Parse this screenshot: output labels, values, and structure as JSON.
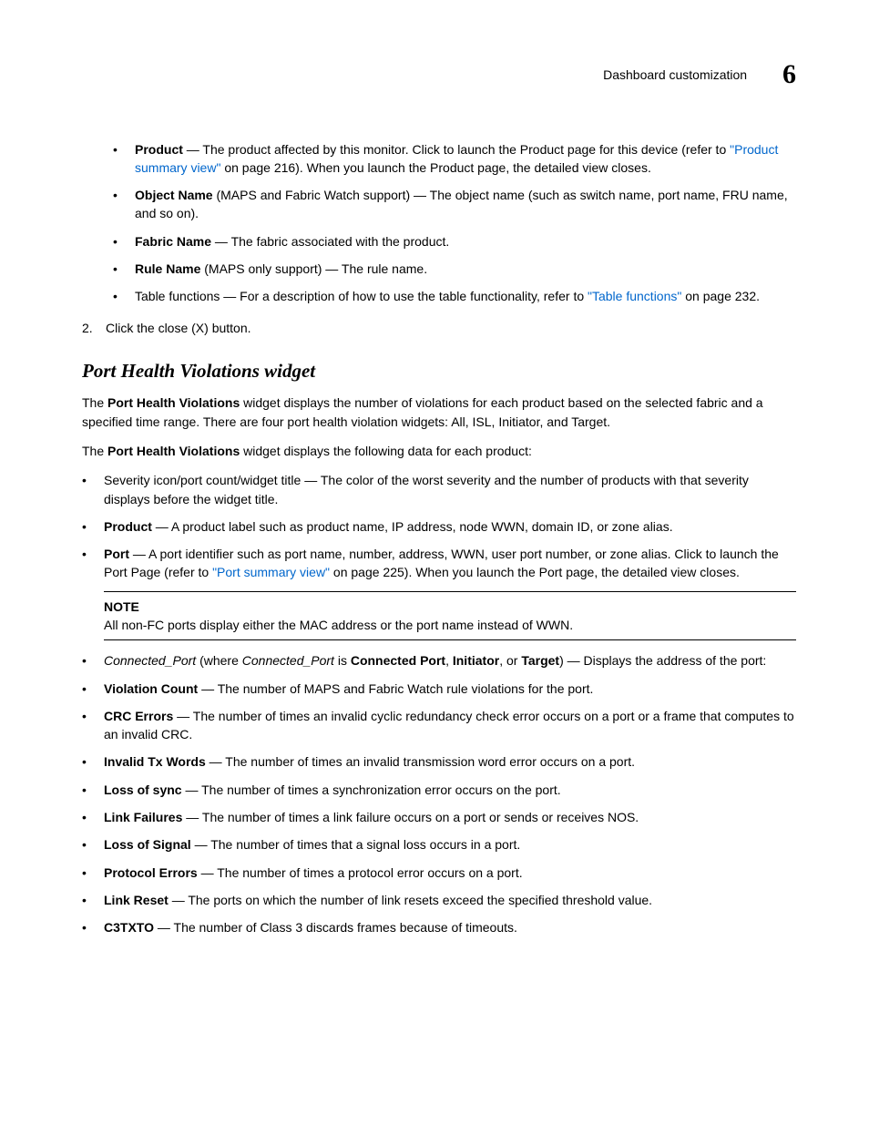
{
  "header": {
    "title": "Dashboard customization",
    "chapter": "6"
  },
  "topList": {
    "product": {
      "term": "Product",
      "t1": " — The product affected by this monitor. Click to launch the Product page for this device (refer to ",
      "link": "\"Product summary view\"",
      "t2": " on page 216). When you launch the Product page, the detailed view closes."
    },
    "objectName": {
      "term": "Object Name",
      "text": " (MAPS and Fabric Watch support) — The object name (such as switch name, port name, FRU name, and so on)."
    },
    "fabricName": {
      "term": "Fabric Name",
      "text": " — The fabric associated with the product."
    },
    "ruleName": {
      "term": "Rule Name",
      "text": " (MAPS only support) — The rule name."
    },
    "tableFunctions": {
      "t1": "Table functions — For a description of how to use the table functionality, refer to ",
      "link": "\"Table functions\"",
      "t2": " on page 232."
    }
  },
  "step2": "Click the close (X) button.",
  "sectionTitle": "Port Health Violations widget",
  "intro": {
    "p1a": "The ",
    "p1b": "Port Health Violations",
    "p1c": " widget displays the number of violations for each product based on the selected fabric and a specified time range. There are four port health violation widgets: All, ISL, Initiator, and Target.",
    "p2a": "The ",
    "p2b": "Port Health Violations",
    "p2c": " widget displays the following data for each product:"
  },
  "mainList": {
    "severity": "Severity icon/port count/widget title — The color of the worst severity and the number of products with that severity displays before the widget title.",
    "product": {
      "term": "Product",
      "text": " — A product label such as product name, IP address, node WWN, domain ID, or zone alias."
    },
    "port": {
      "term": "Port",
      "t1": " — A port identifier such as port name, number, address, WWN, user port number, or zone alias. Click to launch the Port Page (refer to ",
      "link": "\"Port summary view\"",
      "t2": " on page 225). When you launch the Port page, the detailed view closes."
    },
    "note": {
      "title": "NOTE",
      "text": "All non-FC ports display either the MAC address or the port name instead of WWN."
    },
    "connectedPort": {
      "i1": "Connected_Port",
      "t1": " (where ",
      "i2": "Connected_Port",
      "t2": " is ",
      "b1": "Connected Port",
      "t3": ", ",
      "b2": "Initiator",
      "t4": ", or ",
      "b3": "Target",
      "t5": ") — Displays the address of the port:"
    },
    "violationCount": {
      "term": "Violation Count",
      "text": " — The number of MAPS and Fabric Watch rule violations for the port."
    },
    "crcErrors": {
      "term": "CRC Errors",
      "text": " — The number of times an invalid cyclic redundancy check error occurs on a port or a frame that computes to an invalid CRC."
    },
    "invalidTx": {
      "term": "Invalid Tx Words",
      "text": " — The number of times an invalid transmission word error occurs on a port."
    },
    "lossSync": {
      "term": "Loss of sync",
      "text": " — The number of times a synchronization error occurs on the port."
    },
    "linkFailures": {
      "term": "Link Failures",
      "text": " — The number of times a link failure occurs on a port or sends or receives NOS."
    },
    "lossSignal": {
      "term": "Loss of Signal",
      "text": " — The number of times that a signal loss occurs in a port."
    },
    "protocolErrors": {
      "term": "Protocol Errors",
      "text": " — The number of times a protocol error occurs on a port."
    },
    "linkReset": {
      "term": "Link Reset",
      "text": " — The ports on which the number of link resets exceed the specified threshold value."
    },
    "c3txto": {
      "term": "C3TXTO",
      "text": " — The number of Class 3 discards frames because of timeouts."
    }
  }
}
